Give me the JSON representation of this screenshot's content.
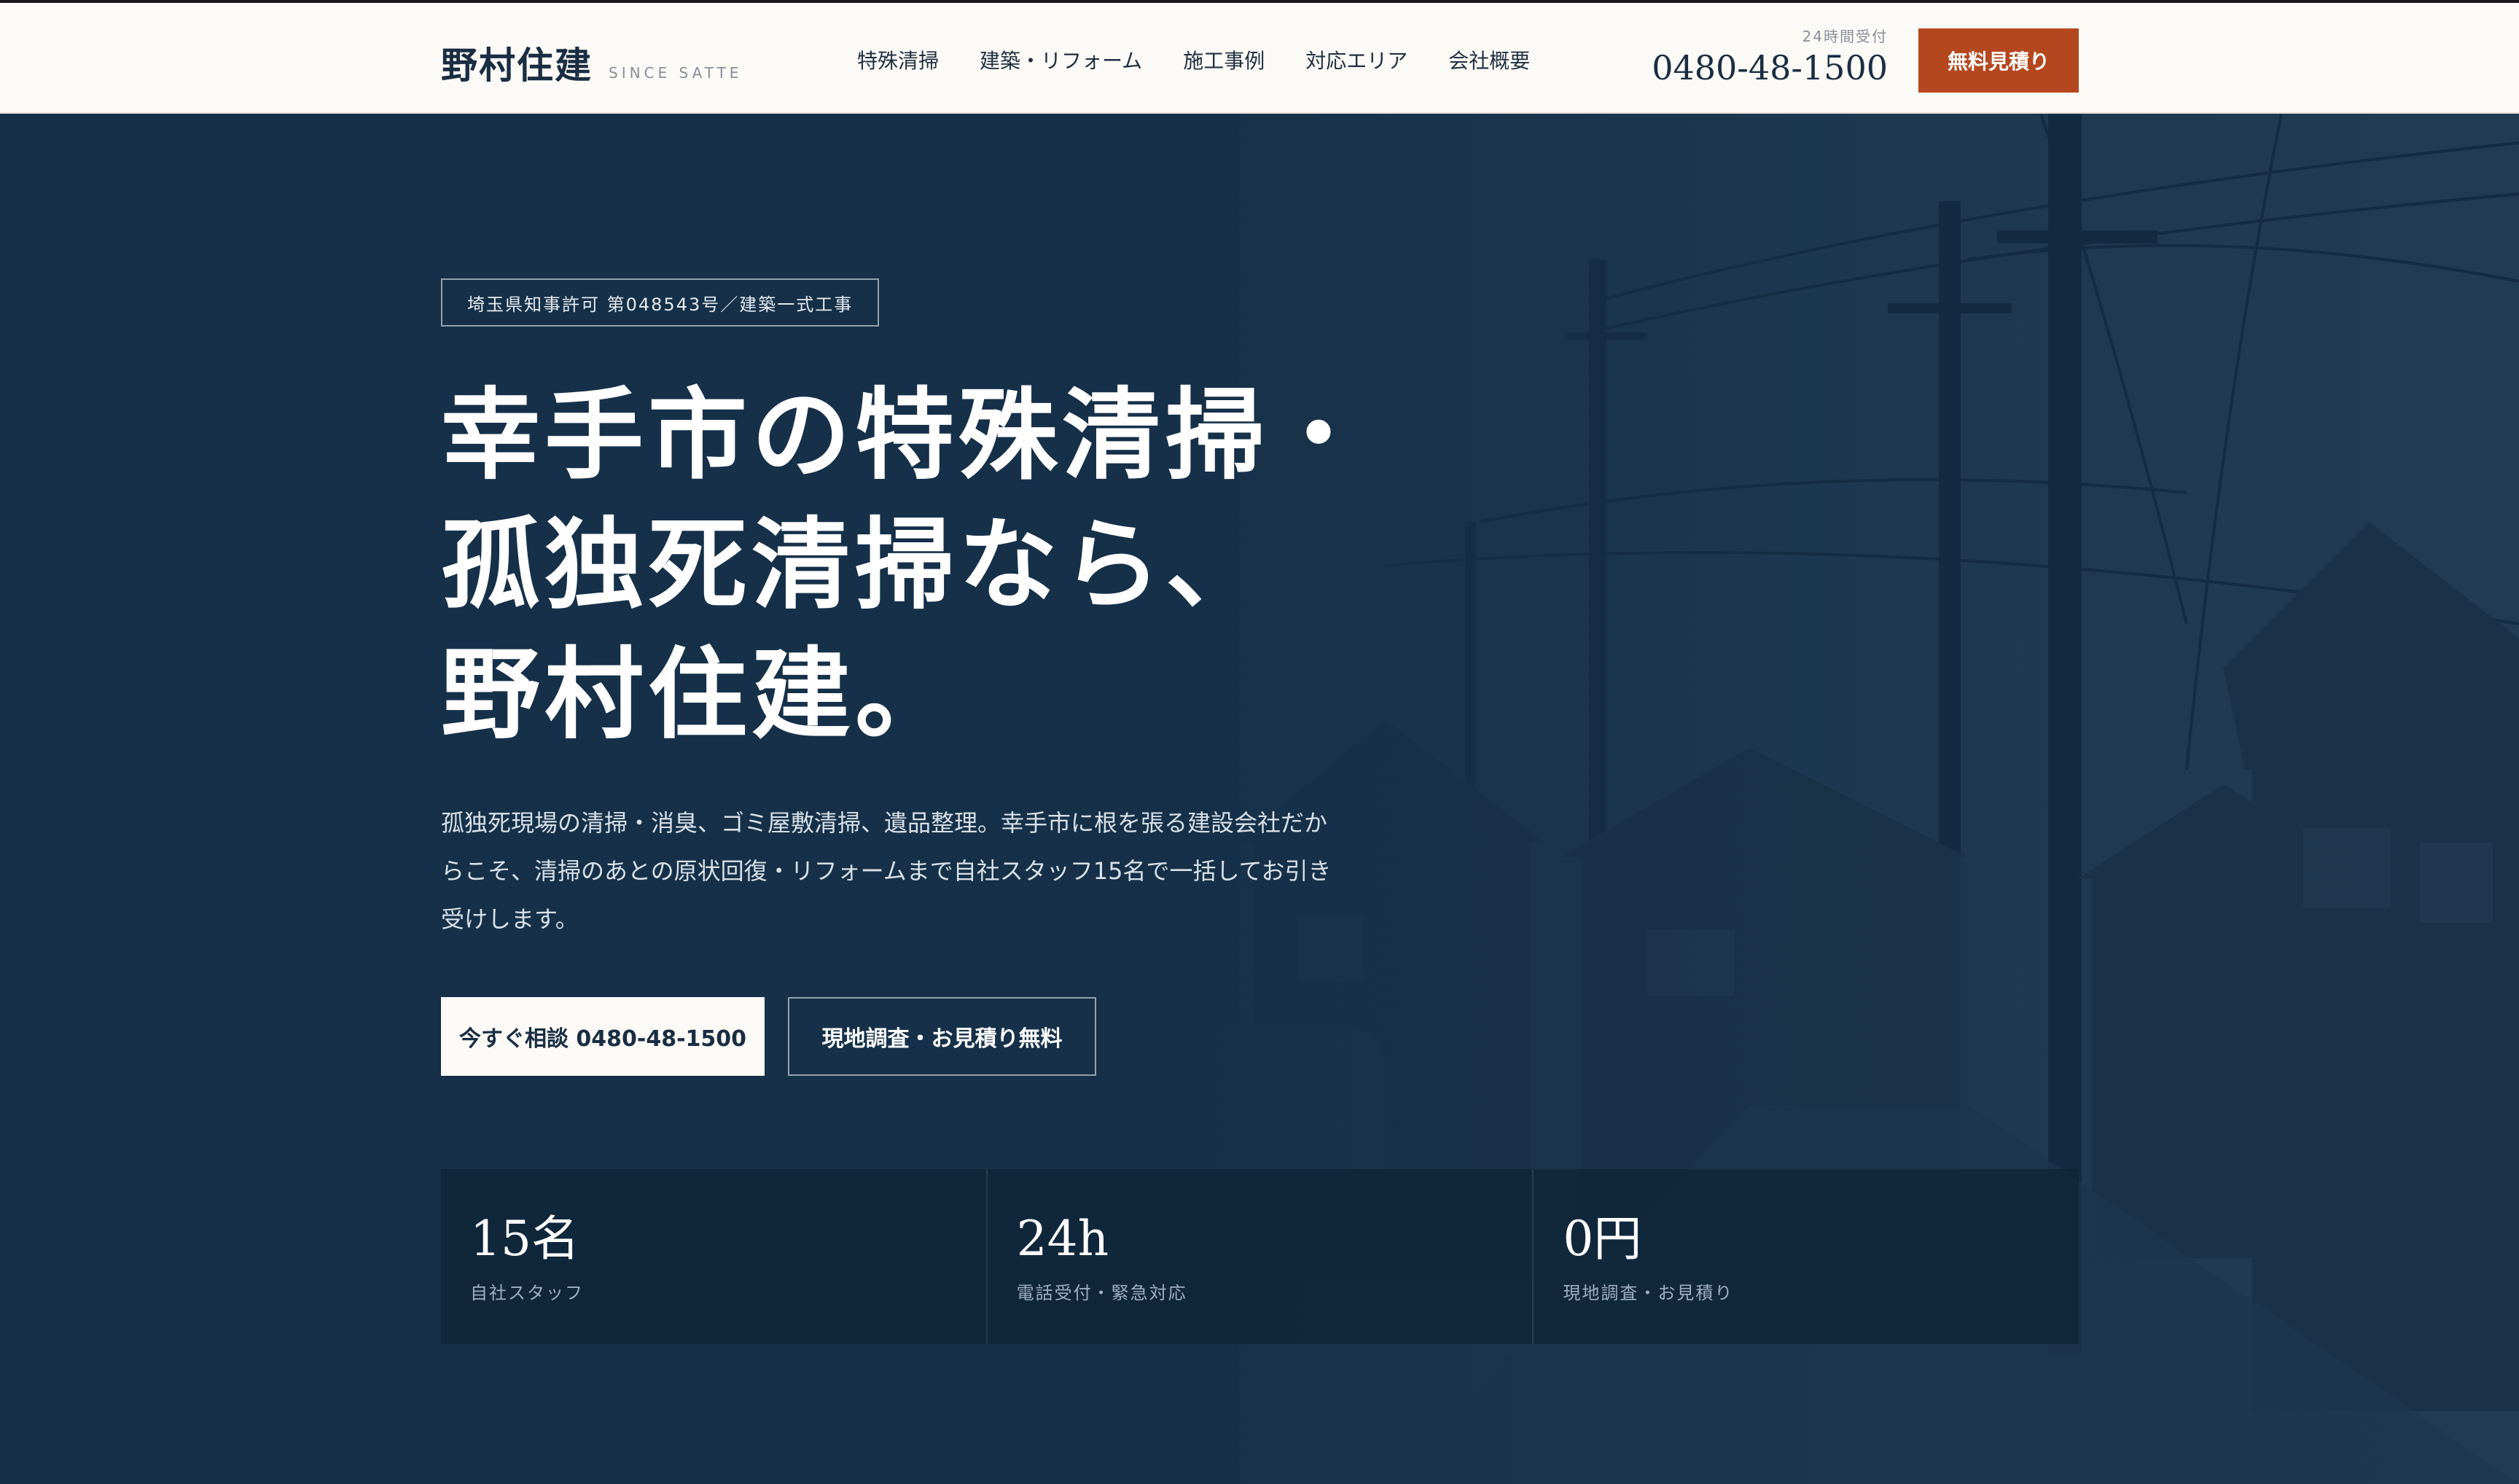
{
  "header": {
    "logo": "野村住建",
    "logo_sub": "SINCE SATTE",
    "nav": [
      "特殊清掃",
      "建築・リフォーム",
      "施工事例",
      "対応エリア",
      "会社概要"
    ],
    "phone_label": "24時間受付",
    "phone_number": "0480-48-1500",
    "cta_label": "無料見積り"
  },
  "hero": {
    "license_badge": "埼玉県知事許可 第048543号／建築一式工事",
    "headline_lines": [
      "幸手市の特殊清掃・",
      "孤独死清掃なら、",
      "野村住建。"
    ],
    "lead": "孤独死現場の清掃・消臭、ゴミ屋敷清掃、遺品整理。幸手市に根を張る建設会社だからこそ、清掃のあとの原状回復・リフォームまで自社スタッフ15名で一括してお引き受けします。",
    "primary_button": "今すぐ相談 0480-48-1500",
    "secondary_button": "現地調査・お見積り無料"
  },
  "stats": [
    {
      "value": "15名",
      "label": "自社スタッフ"
    },
    {
      "value": "24h",
      "label": "電話受付・緊急対応"
    },
    {
      "value": "0円",
      "label": "現地調査・お見積り"
    }
  ],
  "colors": {
    "navy": "#163049",
    "accent": "#b5471f",
    "header_bg": "#fbfaf6"
  }
}
